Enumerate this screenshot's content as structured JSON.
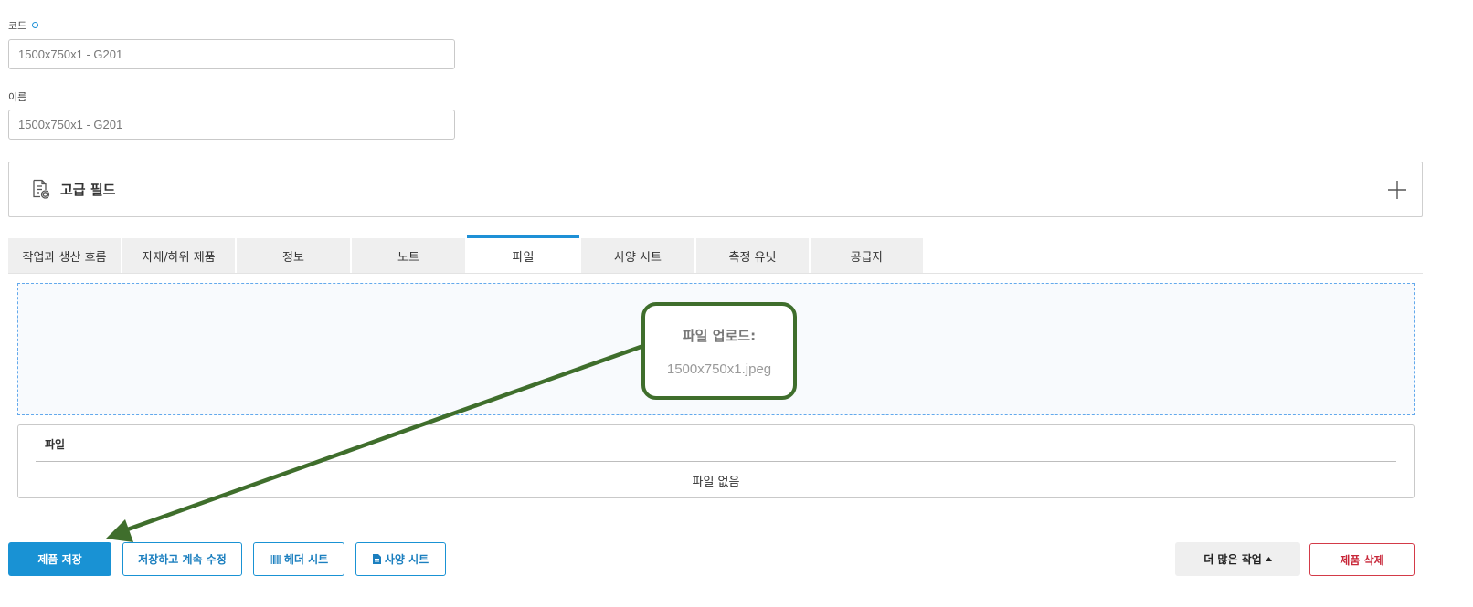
{
  "form": {
    "code": {
      "label": "코드",
      "value": "1500x750x1 - G201"
    },
    "name": {
      "label": "이름",
      "value": "1500x750x1 - G201"
    }
  },
  "advanced": {
    "title": "고급 필드"
  },
  "tabs": [
    {
      "label": "작업과 생산 흐름",
      "active": false
    },
    {
      "label": "자재/하위 제품",
      "active": false
    },
    {
      "label": "정보",
      "active": false
    },
    {
      "label": "노트",
      "active": false
    },
    {
      "label": "파일",
      "active": true
    },
    {
      "label": "사양 시트",
      "active": false
    },
    {
      "label": "측정 유닛",
      "active": false
    },
    {
      "label": "공급자",
      "active": false
    }
  ],
  "upload": {
    "title": "파일 업로드:",
    "filename": "1500x750x1.jpeg"
  },
  "files_table": {
    "header": "파일",
    "empty_text": "파일 없음"
  },
  "actions": {
    "save": "제품 저장",
    "save_continue": "저장하고 계속 수정",
    "header_sheet": "헤더 시트",
    "spec_sheet": "사양 시트",
    "more": "더 많은 작업",
    "delete": "제품 삭제"
  },
  "colors": {
    "accent": "#1992d4",
    "annotation": "#3f6e2c",
    "danger": "#d33a48"
  }
}
